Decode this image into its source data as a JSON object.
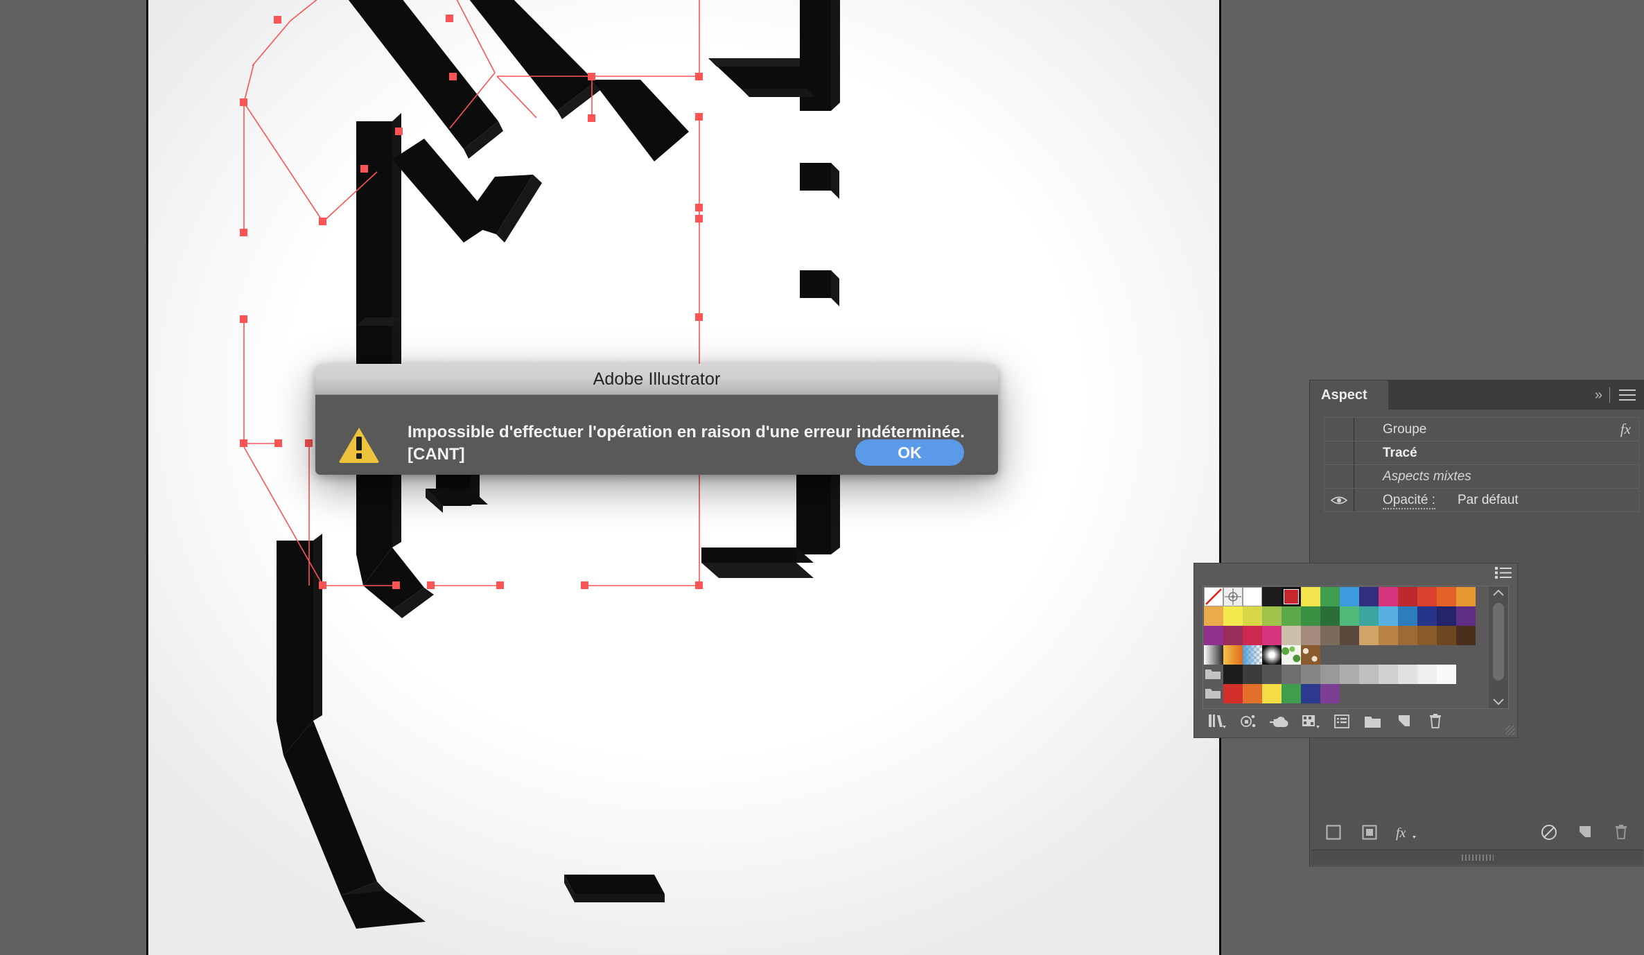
{
  "app": {
    "name": "Adobe Illustrator"
  },
  "dialog": {
    "title": "Adobe Illustrator",
    "message_line1": "Impossible d'effectuer l'opération en raison d'une erreur indéterminée.",
    "message_line2": "[CANT]",
    "ok_label": "OK",
    "icon": "warning-triangle-icon",
    "accent_button_color": "#5b9ae8",
    "warning_color": "#edc23d",
    "body_color": "#595959"
  },
  "aspect_panel": {
    "tab_label": "Aspect",
    "collapse_icon": "double-chevron-right-icon",
    "menu_icon": "panel-menu-icon",
    "rows": [
      {
        "label": "Groupe",
        "style": "normal",
        "value": "",
        "has_fx": true,
        "has_eye": false
      },
      {
        "label": "Tracé",
        "style": "bold",
        "value": "",
        "has_fx": false,
        "has_eye": false
      },
      {
        "label": "Aspects mixtes",
        "style": "italic",
        "value": "",
        "has_fx": false,
        "has_eye": false
      },
      {
        "label": "Opacité :",
        "style": "link",
        "value": "Par défaut",
        "has_fx": false,
        "has_eye": true
      }
    ],
    "footer_icons": [
      "add-new-stroke-icon",
      "add-new-fill-icon",
      "add-new-effect-fx-icon",
      "clear-appearance-icon",
      "duplicate-item-icon",
      "delete-item-icon"
    ]
  },
  "swatches_panel": {
    "menu_icon": "swatch-list-view-icon",
    "footer_icons": [
      "swatch-libraries-icon",
      "show-swatch-kinds-icon",
      "add-to-cc-library-icon",
      "color-group-options-icon",
      "swatch-options-icon",
      "new-color-group-icon",
      "new-swatch-icon",
      "delete-swatch-icon"
    ],
    "selected_swatch_index": 4,
    "rows": [
      {
        "specials": [
          "none",
          "registration",
          "white",
          "blackish"
        ],
        "colors": [
          "#c9252d",
          "#f4e44b",
          "#3f9e4d",
          "#3e9bdd",
          "#30307e",
          "#d8357f",
          "#bc2a2e",
          "#d9402e",
          "#e2622a",
          "#e5992e"
        ]
      },
      {
        "colors": [
          "#eaab4b",
          "#f2e94f",
          "#d7d748",
          "#9ec24a",
          "#5da94c",
          "#3b9143",
          "#2a6e38",
          "#50b97a",
          "#3ca5a0",
          "#57b0e0",
          "#2d7cbc",
          "#26348a",
          "#24246b",
          "#5e2d85"
        ]
      },
      {
        "colors": [
          "#90318d",
          "#982c5a",
          "#cc2a50",
          "#d8357f",
          "#cdc0ab",
          "#a4897c",
          "#7a6b5a",
          "#5b483c",
          "#d0a469",
          "#b98345",
          "#9b6a36",
          "#8a5c2c",
          "#6e4620",
          "#4a301a"
        ]
      },
      {
        "gradients": [
          "linear-gray",
          "linear-orange",
          "checker-blue",
          "radial-white",
          "pattern-leaf",
          "pattern-ornament"
        ]
      },
      {
        "folder": true,
        "colors": [
          "#1c1c1c",
          "#3c3c3c",
          "#545454",
          "#6f6f6f",
          "#858585",
          "#999999",
          "#adadad",
          "#bfbfbf",
          "#d0d0d0",
          "#e2e2e2",
          "#efefef",
          "#fafafa"
        ]
      },
      {
        "folder": true,
        "colors": [
          "#d32f2b",
          "#e0702a",
          "#f3dc45",
          "#3f9e4d",
          "#2b3a8f",
          "#7d3f93"
        ]
      }
    ]
  },
  "canvas": {
    "artwork_description": "3d-extruded-black-letterforms",
    "selection_color": "#fc5454",
    "artboard_background": "#ffffff",
    "workspace_background": "#616161"
  }
}
